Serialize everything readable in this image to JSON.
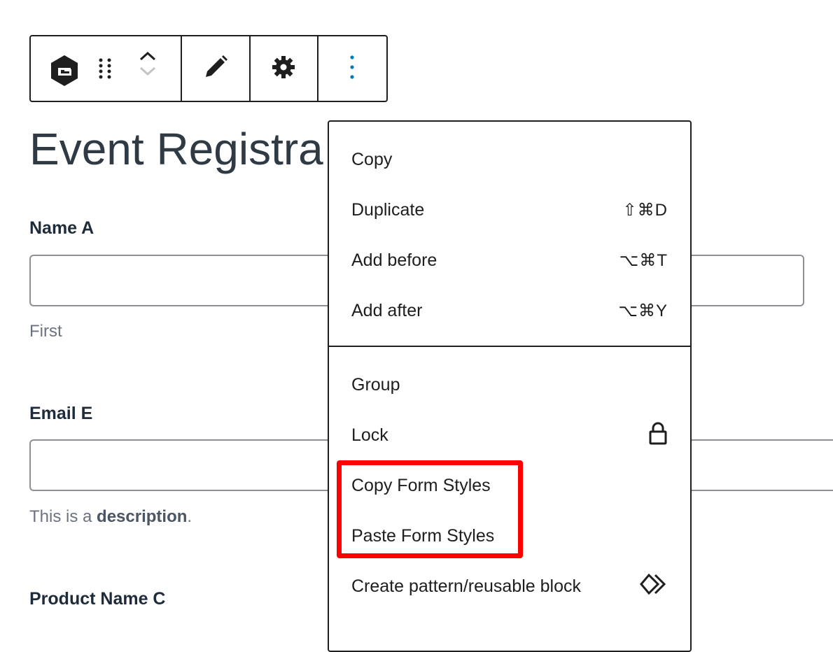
{
  "toolbar": {
    "buttons": [
      {
        "name": "gravity-forms-block-icon",
        "label": "G"
      },
      {
        "name": "drag-handle-icon"
      },
      {
        "name": "move-up-icon"
      },
      {
        "name": "move-down-icon"
      },
      {
        "name": "edit-pencil-icon"
      },
      {
        "name": "gear-icon"
      },
      {
        "name": "more-options-icon"
      }
    ],
    "accent_color": "#007cba"
  },
  "form": {
    "title": "Event Registra",
    "fields": [
      {
        "label": "Name A",
        "sublabel": "First"
      },
      {
        "label": "Email E",
        "description_prefix": "This is a ",
        "description_bold": "description",
        "description_suffix": "."
      },
      {
        "label": "Product Name C"
      }
    ]
  },
  "menu": {
    "items_top": [
      {
        "label": "Copy",
        "shortcut": ""
      },
      {
        "label": "Duplicate",
        "shortcut": "⇧⌘D"
      },
      {
        "label": "Add before",
        "shortcut": "⌥⌘T"
      },
      {
        "label": "Add after",
        "shortcut": "⌥⌘Y"
      }
    ],
    "items_bottom": [
      {
        "label": "Group",
        "icon": ""
      },
      {
        "label": "Lock",
        "icon": "lock-icon"
      },
      {
        "label": "Copy Form Styles",
        "icon": ""
      },
      {
        "label": "Paste Form Styles",
        "icon": ""
      },
      {
        "label": "Create pattern/reusable block",
        "icon": "reusable-block-icon"
      }
    ],
    "highlight_color": "#ff0000"
  }
}
